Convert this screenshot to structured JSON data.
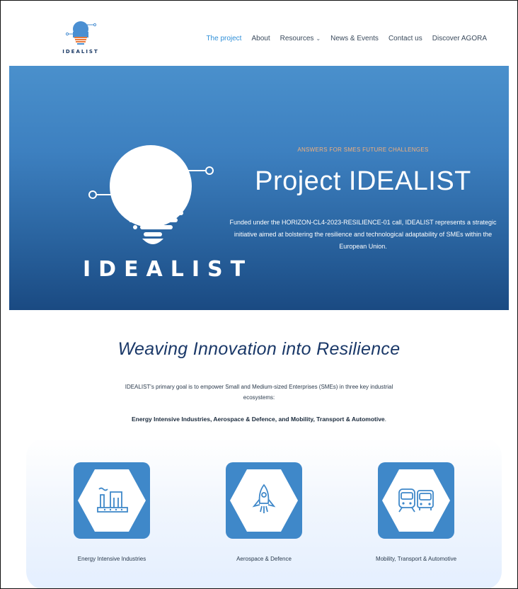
{
  "header": {
    "logo_text": "IDEALIST",
    "nav": [
      {
        "label": "The project",
        "active": true,
        "has_caret": false
      },
      {
        "label": "About",
        "active": false,
        "has_caret": false
      },
      {
        "label": "Resources",
        "active": false,
        "has_caret": true
      },
      {
        "label": "News & Events",
        "active": false,
        "has_caret": false
      },
      {
        "label": "Contact us",
        "active": false,
        "has_caret": false
      },
      {
        "label": "Discover AGORA",
        "active": false,
        "has_caret": false
      }
    ],
    "caret_icon": "chevron-down-icon"
  },
  "hero": {
    "brand": "IDEALIST",
    "eyebrow": "ANSWERS FOR SMES FUTURE CHALLENGES",
    "title": "Project IDEALIST",
    "description": "Funded under the HORIZON-CL4-2023-RESILIENCE-01 call, IDEALIST represents a strategic initiative aimed at bolstering the resilience and technological adaptability of SMEs within the European Union.",
    "eyebrow_color": "#f5b07a"
  },
  "section": {
    "title": "Weaving Innovation into Resilience",
    "description": "IDEALIST's primary goal is to empower Small and Medium-sized Enterprises (SMEs) in three key industrial ecosystems:",
    "ecosystems_bold": "Energy Intensive Industries,  Aerospace & Defence, and Mobility, Transport & Automotive",
    "ecosystems_tail": "."
  },
  "cards": [
    {
      "label": "Energy Intensive Industries",
      "icon": "factory-icon"
    },
    {
      "label": "Aerospace & Defence",
      "icon": "rocket-icon"
    },
    {
      "label": "Mobility, Transport & Automotive",
      "icon": "train-bus-icon"
    }
  ],
  "colors": {
    "accent": "#2f8fd8",
    "card_bg": "#3f88c9",
    "title_navy": "#1a3868"
  }
}
